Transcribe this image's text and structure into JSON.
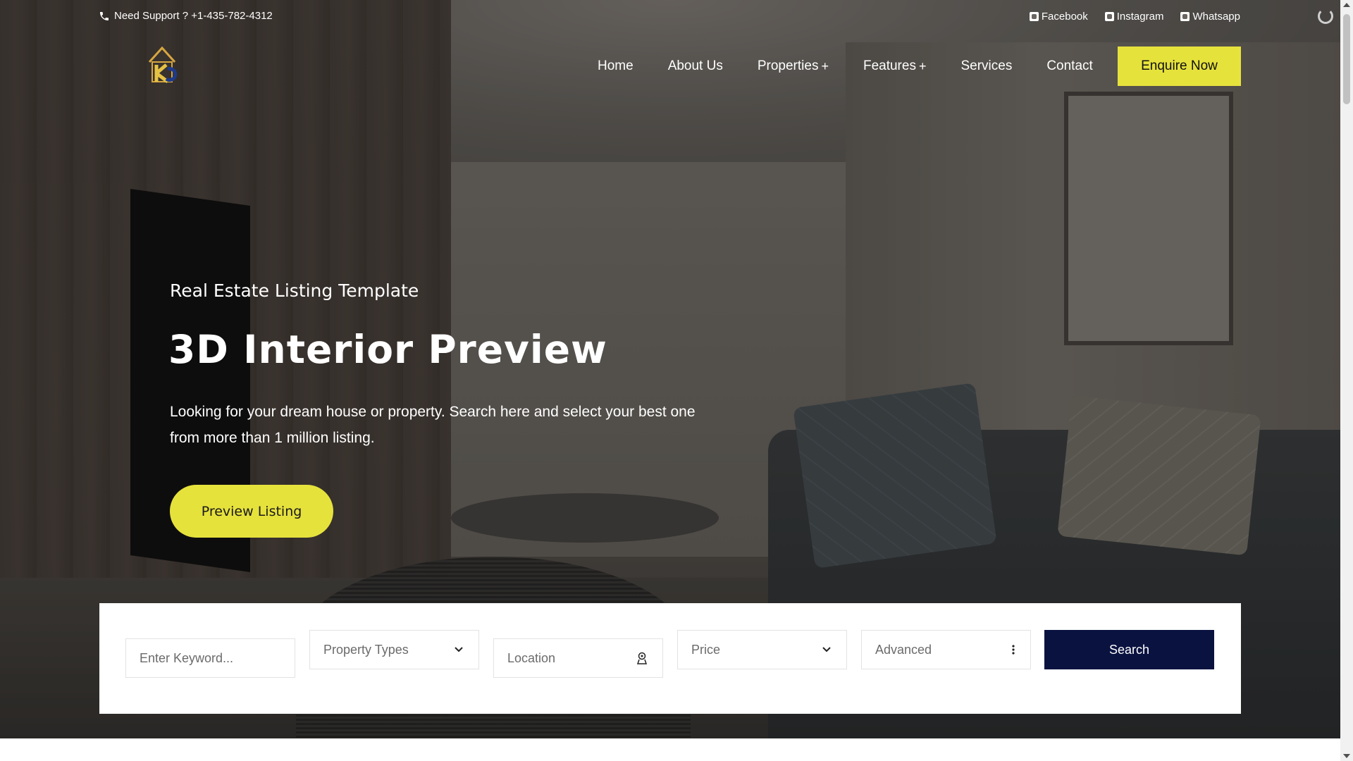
{
  "topbar": {
    "support_text": "Need Support ? +1-435-782-4312",
    "social": [
      {
        "label": "Facebook",
        "icon": "facebook-icon"
      },
      {
        "label": "Instagram",
        "icon": "instagram-icon"
      },
      {
        "label": "Whatsapp",
        "icon": "whatsapp-icon"
      }
    ]
  },
  "nav": {
    "items": [
      {
        "label": "Home",
        "has_submenu": false
      },
      {
        "label": "About Us",
        "has_submenu": false
      },
      {
        "label": "Properties",
        "has_submenu": true
      },
      {
        "label": "Features",
        "has_submenu": true
      },
      {
        "label": "Services",
        "has_submenu": false
      },
      {
        "label": "Contact",
        "has_submenu": false
      }
    ],
    "submenu_indicator": "+",
    "cta_label": "Enquire Now"
  },
  "hero": {
    "subtitle": "Real Estate Listing Template",
    "title": "3D Interior Preview",
    "description": "Looking for your dream house or property. Search here and select your best one from more than 1 million listing.",
    "button_label": "Preview Listing"
  },
  "search": {
    "keyword_placeholder": "Enter Keyword...",
    "property_types_label": "Property Types",
    "location_placeholder": "Location",
    "price_label": "Price",
    "advanced_label": "Advanced",
    "search_button_label": "Search"
  },
  "colors": {
    "accent": "#e6e23c",
    "search_button": "#0a1240",
    "text_light": "#ffffff"
  }
}
